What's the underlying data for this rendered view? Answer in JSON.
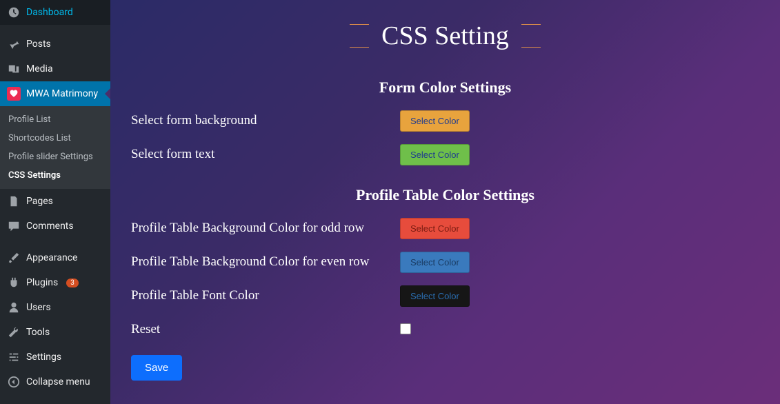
{
  "sidebar": {
    "items": [
      {
        "label": "Dashboard"
      },
      {
        "label": "Posts"
      },
      {
        "label": "Media"
      },
      {
        "label": "MWA Matrimony"
      },
      {
        "label": "Pages"
      },
      {
        "label": "Comments"
      },
      {
        "label": "Appearance"
      },
      {
        "label": "Plugins"
      },
      {
        "label": "Users"
      },
      {
        "label": "Tools"
      },
      {
        "label": "Settings"
      },
      {
        "label": "Collapse menu"
      }
    ],
    "plugins_badge": "3",
    "submenu": [
      {
        "label": "Profile List"
      },
      {
        "label": "Shortcodes List"
      },
      {
        "label": "Profile slider Settings"
      },
      {
        "label": "CSS Settings"
      }
    ]
  },
  "page": {
    "title": "CSS Setting",
    "section1": "Form Color Settings",
    "section2": "Profile Table Color Settings",
    "rows": {
      "form_bg": "Select form background",
      "form_text": "Select form text",
      "odd_row": "Profile Table Background Color for odd row",
      "even_row": "Profile Table Background Color for even row",
      "font": "Profile Table Font Color",
      "reset": "Reset"
    },
    "select_color": "Select Color",
    "save": "Save"
  }
}
